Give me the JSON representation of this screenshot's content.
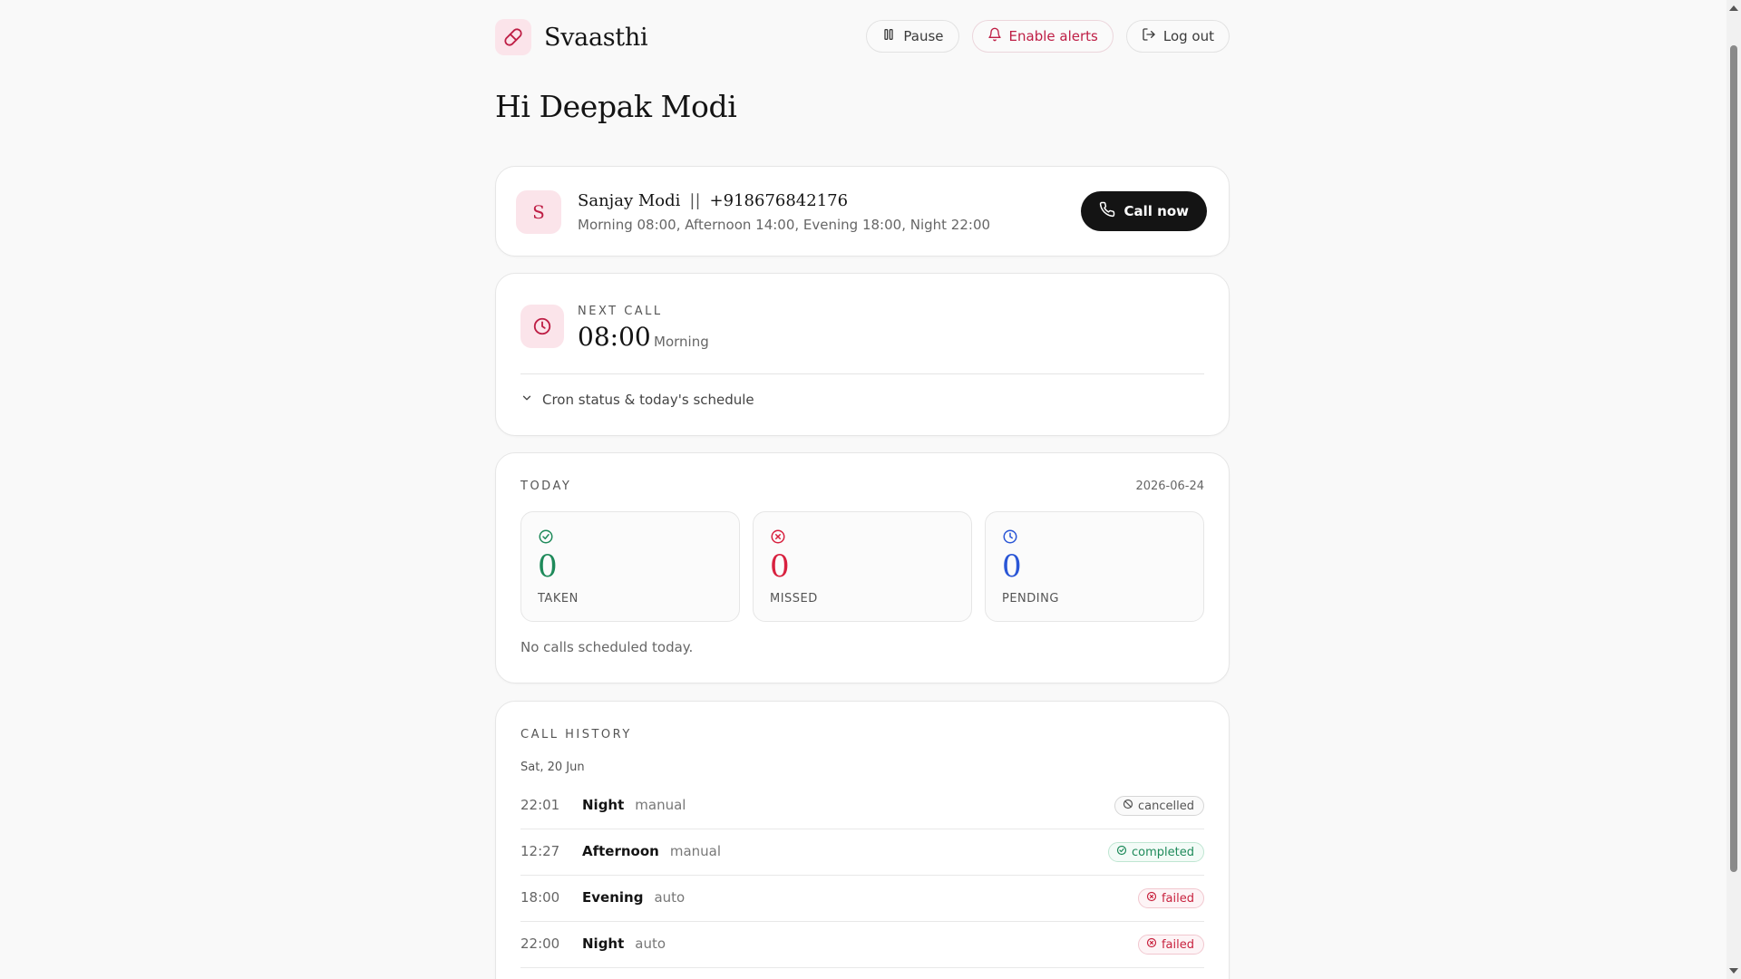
{
  "app": {
    "name": "Svaasthi"
  },
  "header": {
    "pause_label": "Pause",
    "alerts_label": "Enable alerts",
    "logout_label": "Log out"
  },
  "greeting": "Hi Deepak Modi",
  "patient": {
    "avatar_initial": "S",
    "name": "Sanjay Modi",
    "separator": "||",
    "phone": "+918676842176",
    "schedule": "Morning 08:00, Afternoon 14:00, Evening 18:00, Night 22:00",
    "call_label": "Call now"
  },
  "next_call": {
    "label": "NEXT CALL",
    "time": "08:00",
    "slot": "Morning",
    "cron_toggle_label": "Cron status & today's schedule"
  },
  "today": {
    "label": "TODAY",
    "date": "2026-06-24",
    "stats": [
      {
        "key": "taken",
        "value": "0",
        "label": "TAKEN",
        "color": "#1e8a5a"
      },
      {
        "key": "missed",
        "value": "0",
        "label": "MISSED",
        "color": "#d8213f"
      },
      {
        "key": "pending",
        "value": "0",
        "label": "PENDING",
        "color": "#2a56d6"
      }
    ],
    "empty_message": "No calls scheduled today."
  },
  "history": {
    "label": "CALL HISTORY",
    "day": "Sat, 20 Jun",
    "rows": [
      {
        "time": "22:01",
        "slot": "Night",
        "type": "manual",
        "status": "cancelled"
      },
      {
        "time": "12:27",
        "slot": "Afternoon",
        "type": "manual",
        "status": "completed"
      },
      {
        "time": "18:00",
        "slot": "Evening",
        "type": "auto",
        "status": "failed"
      },
      {
        "time": "22:00",
        "slot": "Night",
        "type": "auto",
        "status": "failed"
      }
    ]
  },
  "colors": {
    "brand_accent": "#be1e45",
    "brand_tint": "#fbe4ea",
    "dark_button": "#141414"
  },
  "icons": {
    "brand": "pill-icon",
    "pause": "pause-icon",
    "alerts": "bell-icon",
    "logout": "logout-icon",
    "call": "phone-icon",
    "next_call": "clock-icon",
    "cron_toggle": "chevron-down-icon"
  }
}
